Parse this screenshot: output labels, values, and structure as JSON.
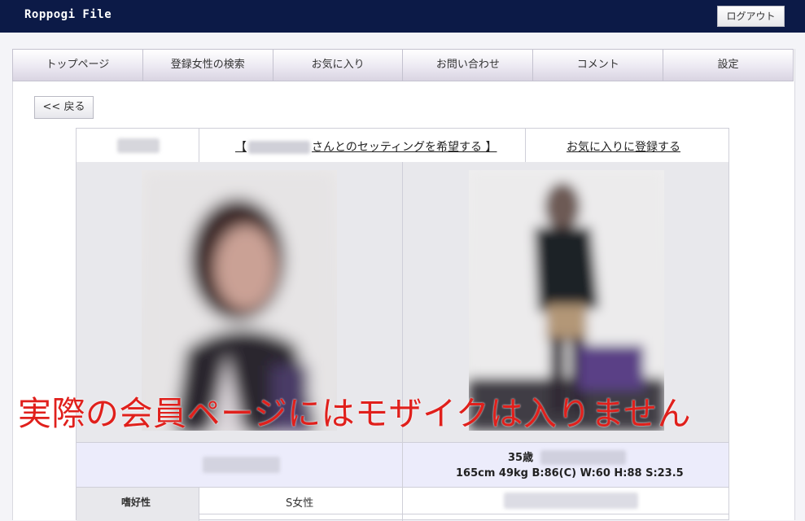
{
  "header": {
    "brand": "Roppogi File",
    "logout_label": "ログアウト"
  },
  "nav": {
    "items": [
      {
        "label": "トップページ"
      },
      {
        "label": "登録女性の検索"
      },
      {
        "label": "お気に入り"
      },
      {
        "label": "お問い合わせ"
      },
      {
        "label": "コメント"
      },
      {
        "label": "設定"
      }
    ]
  },
  "back_label": "<< 戻る",
  "profile": {
    "setting_request_prefix": "【",
    "setting_request_suffix": "さんとのセッティングを希望する 】",
    "favorite_link": "お気に入りに登録する",
    "age": "35歳",
    "measurements": "165cm 49kg B:86(C) W:60 H:88 S:23.5",
    "preference_label": "嗜好性",
    "preference_value": "S女性"
  },
  "notice": "実際の会員ページにはモザイクは入りません",
  "colors": {
    "header_bg": "#0c1a47",
    "notice_text": "#e0201c",
    "info_row_bg": "#ececfb"
  }
}
